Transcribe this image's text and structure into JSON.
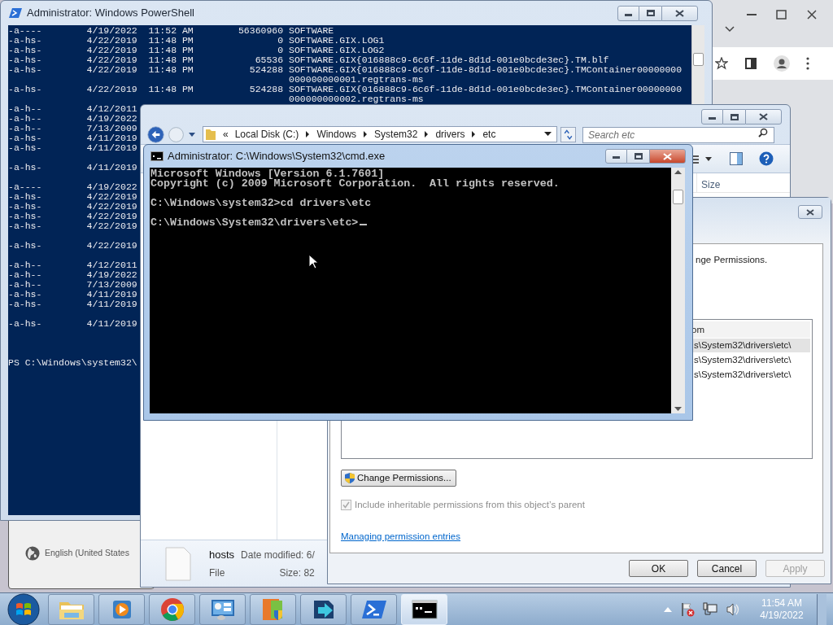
{
  "powershell": {
    "title": "Administrator: Windows PowerShell",
    "blocks": [
      [
        "-a----        4/19/2022  11:52 AM        56360960 SOFTWARE",
        "-a-hs-        4/22/2019  11:48 PM               0 SOFTWARE.GIX.LOG1",
        "-a-hs-        4/22/2019  11:48 PM               0 SOFTWARE.GIX.LOG2",
        "-a-hs-        4/22/2019  11:48 PM           65536 SOFTWARE.GIX{016888c9-6c6f-11de-8d1d-001e0bcde3ec}.TM.blf",
        "-a-hs-        4/22/2019  11:48 PM          524288 SOFTWARE.GIX{016888c9-6c6f-11de-8d1d-001e0bcde3ec}.TMContainer00000000",
        "                                                  000000000001.regtrans-ms",
        "-a-hs-        4/22/2019  11:48 PM          524288 SOFTWARE.GIX{016888c9-6c6f-11de-8d1d-001e0bcde3ec}.TMContainer00000000",
        "                                                  000000000002.regtrans-ms",
        "-a-h--        4/12/2011",
        "-a-h--        4/19/2022",
        "-a-h--        7/13/2009",
        "-a-hs-        4/11/2019",
        "-a-hs-        4/11/2019"
      ],
      [
        "-a-hs-        4/11/2019"
      ],
      [
        "-a----        4/19/2022",
        "-a-hs-        4/22/2019",
        "-a-hs-        4/22/2019",
        "-a-hs-        4/22/2019",
        "-a-hs-        4/22/2019"
      ],
      [
        "-a-hs-        4/22/2019"
      ],
      [
        "-a-h--        4/12/2011",
        "-a-h--        4/19/2022",
        "-a-h--        7/13/2009",
        "-a-hs-        4/11/2019",
        "-a-hs-        4/11/2019"
      ],
      [
        "-a-hs-        4/11/2019"
      ]
    ],
    "prompt": "PS C:\\Windows\\system32\\"
  },
  "language_bar": {
    "label": "English (United States"
  },
  "explorer": {
    "address": {
      "prefix": "«",
      "segments": [
        "Local Disk (C:)",
        "Windows",
        "System32",
        "drivers",
        "etc"
      ]
    },
    "search": {
      "placeholder": "Search etc"
    },
    "columns": [
      "Size"
    ],
    "details": {
      "name": "hosts",
      "date_modified": "Date modified: 6/",
      "type": "File",
      "size": "Size: 82"
    }
  },
  "security_dialog": {
    "instruction": "nge Permissions.",
    "list": {
      "header": "om",
      "rows": [
        {
          "text": "s\\System32\\drivers\\etc\\",
          "selected": true
        },
        {
          "text": "s\\System32\\drivers\\etc\\",
          "selected": false
        },
        {
          "text": "s\\System32\\drivers\\etc\\",
          "selected": false
        }
      ]
    },
    "change_button": "Change Permissions...",
    "inherit": {
      "label": "Include inheritable permissions from this object’s parent",
      "checked": true,
      "disabled": true
    },
    "link": "Managing permission entries",
    "buttons": [
      {
        "label": "OK",
        "disabled": false
      },
      {
        "label": "Cancel",
        "disabled": false
      },
      {
        "label": "Apply",
        "disabled": true
      }
    ]
  },
  "cmd": {
    "title": "Administrator: C:\\Windows\\System32\\cmd.exe",
    "blocks": [
      [
        "Microsoft Windows [Version 6.1.7601]",
        "Copyright (c) 2009 Microsoft Corporation.  All rights reserved."
      ],
      [
        "C:\\Windows\\system32>cd drivers\\etc"
      ],
      [
        "C:\\Windows\\System32\\drivers\\etc>"
      ]
    ]
  },
  "taskbar": {
    "items": [
      {
        "kind": "folder",
        "selected": false
      },
      {
        "kind": "media",
        "selected": false
      },
      {
        "kind": "chrome",
        "selected": false
      },
      {
        "kind": "panel",
        "selected": false
      },
      {
        "kind": "shield",
        "selected": false
      },
      {
        "kind": "transfer",
        "selected": false
      },
      {
        "kind": "powershell",
        "selected": false
      },
      {
        "kind": "console",
        "selected": true
      }
    ],
    "clock": {
      "time": "11:54 AM",
      "date": "4/19/2022"
    }
  }
}
